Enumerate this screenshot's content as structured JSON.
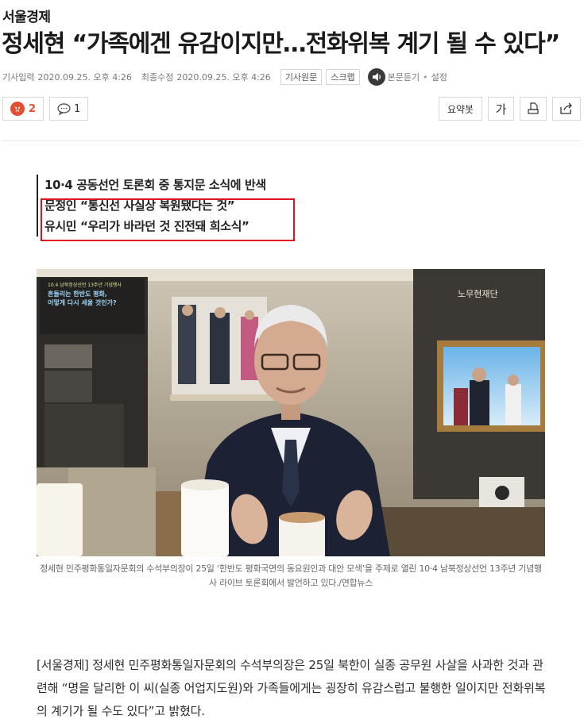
{
  "publisher": "서울경제",
  "headline": "정세현 “가족에겐 유감이지만…전화위복 계기 될 수 있다”",
  "meta": {
    "published_label": "기사입력",
    "published": "2020.09.25. 오후 4:26",
    "modified_label": "최종수정",
    "modified": "2020.09.25. 오후 4:26",
    "original_button": "기사원문",
    "scrap_button": "스크랩",
    "listen_label": "본문듣기",
    "settings_label": "설정",
    "separator": "•"
  },
  "reactions": {
    "angry_count": "2",
    "comment_count": "1"
  },
  "tools": {
    "summary_label": "요약봇",
    "font_label": "가"
  },
  "subheads": [
    "10·4 공동선언 토론회 중 통지문 소식에 반색",
    "문정인 “통신선 사실상 복원됐다는 것”",
    "유시민 “우리가 바라던 것 진전돼 희소식”"
  ],
  "photo": {
    "banner_line1": "10.4 남북정상선언 13주년 기념행사",
    "banner_line2": "흔들리는 한반도 평화,",
    "banner_line3": "어떻게 다시 세울 것인가?",
    "watermark": "노무현재단"
  },
  "caption": "정세현 민주평화통일자문회의 수석부의장이 25일 ‘한반도 평화국면의 동요원인과 대안 모색’을 주제로 열린 10·4 남북정상선언 13주년 기념행사 라이브 토론회에서 발언하고 있다./연합뉴스",
  "body": "[서울경제] 정세현 민주평화통일자문회의 수석부의장은 25일 북한이 실종 공무원 사살을 사과한 것과 관련해 “명을 달리한 이 씨(실종 어업지도원)와 가족들에게는 굉장히 유감스럽고 불행한 일이지만 전화위복의 계기가 될 수도 있다”고 밝혔다.",
  "colors": {
    "accent_red": "#e3101d",
    "angry_orange": "#e24f33"
  }
}
